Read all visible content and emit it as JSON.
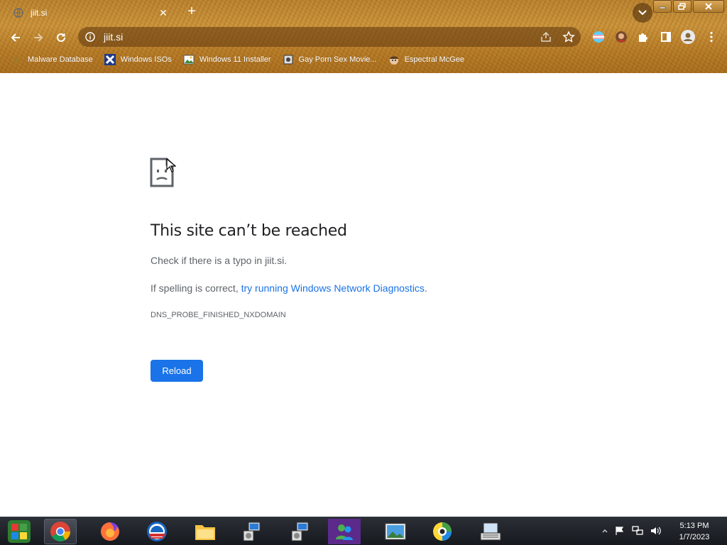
{
  "tab": {
    "title": "jiit.si",
    "favicon": "globe-icon",
    "close": "✕",
    "new_tab": "+"
  },
  "address_bar": {
    "url": "jiit.si",
    "site_info_icon": "info-icon"
  },
  "bookmarks": [
    {
      "label": "Malware Database",
      "icon": "folder-icon"
    },
    {
      "label": "Windows ISOs",
      "icon": "x-icon"
    },
    {
      "label": "Windows 11 Installer",
      "icon": "image-icon"
    },
    {
      "label": "Gay Porn Sex Movie...",
      "icon": "disk-icon"
    },
    {
      "label": "Espectral McGee",
      "icon": "face-icon"
    }
  ],
  "error": {
    "title": "This site can’t be reached",
    "line1": "Check if there is a typo in jiit.si.",
    "line2_prefix": "If spelling is correct, ",
    "line2_link": "try running Windows Network Diagnostics",
    "line2_suffix": ".",
    "code": "DNS_PROBE_FINISHED_NXDOMAIN",
    "reload_label": "Reload"
  },
  "taskbar": {
    "apps": [
      "start-orb",
      "chrome",
      "firefox",
      "obama-logo",
      "file-explorer",
      "network-setup-1",
      "network-setup-2",
      "messenger",
      "photo-viewer",
      "camera-app",
      "on-screen-keyboard"
    ],
    "time": "5:13 PM",
    "date": "1/7/2023"
  },
  "colors": {
    "accent": "#1a73e8",
    "title_text": "#202124",
    "body_text": "#5f6368",
    "chrome_bg": "#b9822f"
  }
}
